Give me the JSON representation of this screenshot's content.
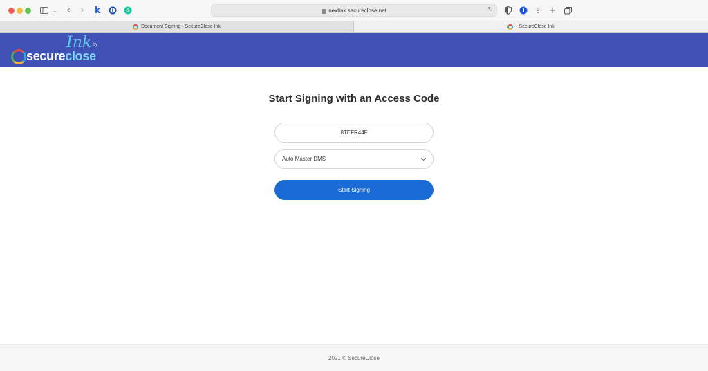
{
  "browser": {
    "url": "nextink.secureclose.net",
    "tabs": [
      {
        "title": "Document Signing - SecureClose Ink"
      },
      {
        "title": "- SecureClose Ink"
      }
    ]
  },
  "brand": {
    "ink": "Ink",
    "by": "by",
    "word_secure": "secure",
    "word_close": "close",
    "header_color": "#3f51b5"
  },
  "form": {
    "title": "Start Signing with an Access Code",
    "access_code": "8TEFR44F",
    "dms_selected": "Auto Master DMS",
    "submit_label": "Start Signing",
    "button_color": "#1a6bd6"
  },
  "footer": {
    "text": "2021 © SecureClose"
  }
}
